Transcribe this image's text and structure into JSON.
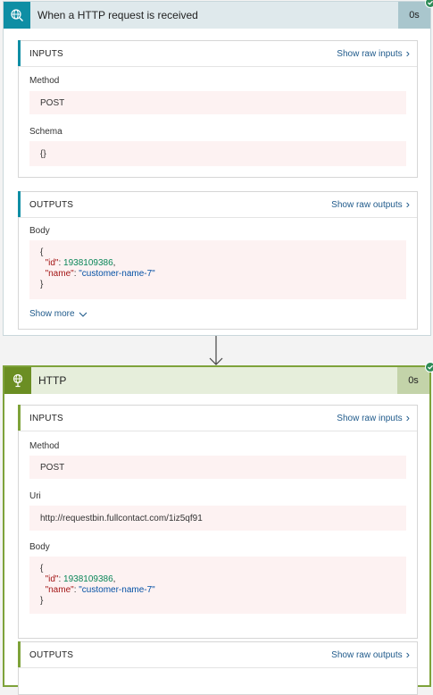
{
  "trigger": {
    "title": "When a HTTP request is received",
    "duration": "0s",
    "icon": "http-request-globe-icon",
    "accent": "#0f8ea4",
    "inputs": {
      "label": "INPUTS",
      "raw_link": "Show raw inputs",
      "method_label": "Method",
      "method_value": "POST",
      "schema_label": "Schema",
      "schema_value": "{}"
    },
    "outputs": {
      "label": "OUTPUTS",
      "raw_link": "Show raw outputs",
      "body_label": "Body",
      "body": {
        "open": "{",
        "id_key": "\"id\"",
        "id_value": "1938109386",
        "name_key": "\"name\"",
        "name_value": "\"customer-name-7\"",
        "close": "}"
      },
      "show_more": "Show more"
    }
  },
  "action": {
    "title": "HTTP",
    "duration": "0s",
    "icon": "http-globe-icon",
    "accent": "#6b8e23",
    "inputs": {
      "label": "INPUTS",
      "raw_link": "Show raw inputs",
      "method_label": "Method",
      "method_value": "POST",
      "uri_label": "Uri",
      "uri_value": "http://requestbin.fullcontact.com/1iz5qf91",
      "body_label": "Body",
      "body": {
        "open": "{",
        "id_key": "\"id\"",
        "id_value": "1938109386",
        "name_key": "\"name\"",
        "name_value": "\"customer-name-7\"",
        "close": "}"
      }
    },
    "outputs": {
      "label": "OUTPUTS",
      "raw_link": "Show raw outputs"
    }
  }
}
